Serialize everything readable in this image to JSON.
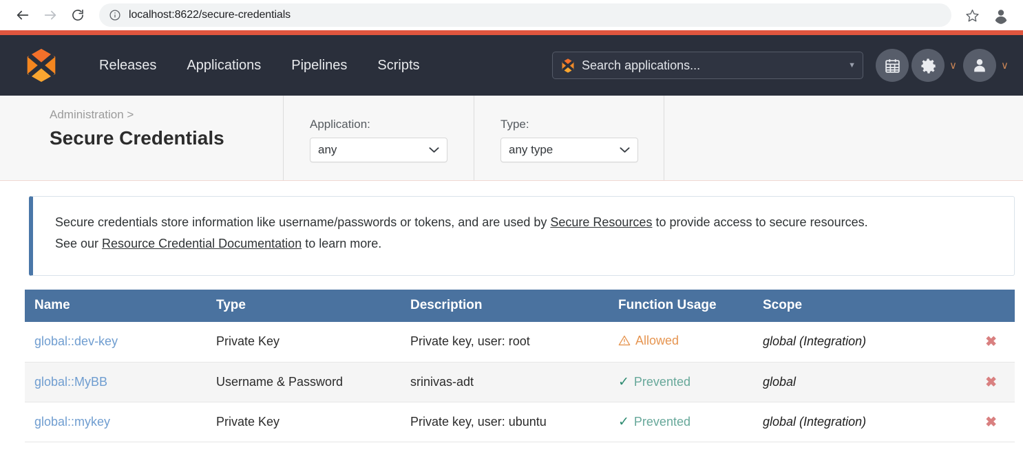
{
  "browser": {
    "back_icon": "arrow-left-icon",
    "forward_icon": "arrow-right-icon",
    "reload_icon": "reload-icon",
    "info_icon": "info-circle-icon",
    "url": "localhost:8622/secure-credentials",
    "star_icon": "star-icon",
    "profile_icon": "profile-avatar-icon"
  },
  "appnav": {
    "logo_name": "xebialabs-logo",
    "links": [
      {
        "label": "Releases"
      },
      {
        "label": "Applications"
      },
      {
        "label": "Pipelines"
      },
      {
        "label": "Scripts"
      }
    ],
    "search": {
      "placeholder": "Search applications...",
      "value": "",
      "logo_icon": "app-hex-logo-icon",
      "caret_icon": "caret-down-icon"
    },
    "actions": [
      {
        "name": "calendar-button",
        "icon": "calendar-icon",
        "chevron": ""
      },
      {
        "name": "settings-button",
        "icon": "gear-icon",
        "chevron": "∨"
      },
      {
        "name": "user-button",
        "icon": "user-icon",
        "chevron": "∨"
      }
    ]
  },
  "header": {
    "breadcrumb": "Administration >",
    "title": "Secure Credentials",
    "filters": [
      {
        "label": "Application:",
        "value": "any",
        "name": "application-filter"
      },
      {
        "label": "Type:",
        "value": "any type",
        "name": "type-filter"
      }
    ]
  },
  "banner": {
    "line1_part1": "Secure credentials store information like username/passwords or tokens, and are used by ",
    "line1_link": "Secure Resources",
    "line1_part2": " to provide access to secure resources.",
    "line2_part1": "See our ",
    "line2_link": "Resource Credential Documentation",
    "line2_part2": " to learn more."
  },
  "table": {
    "columns": [
      "Name",
      "Type",
      "Description",
      "Function Usage",
      "Scope",
      ""
    ],
    "rows": [
      {
        "name": "global::dev-key",
        "type": "Private Key",
        "description": "Private key, user: root",
        "usage": "Allowed",
        "usage_state": "allowed",
        "usage_icon": "warning-triangle-icon",
        "scope": "global (Integration)",
        "delete_icon": "delete-x-icon"
      },
      {
        "name": "global::MyBB",
        "type": "Username & Password",
        "description": "srinivas-adt",
        "usage": "Prevented",
        "usage_state": "prevented",
        "usage_icon": "check-icon",
        "scope": "global",
        "delete_icon": "delete-x-icon"
      },
      {
        "name": "global::mykey",
        "type": "Private Key",
        "description": "Private key, user: ubuntu",
        "usage": "Prevented",
        "usage_state": "prevented",
        "usage_icon": "check-icon",
        "scope": "global (Integration)",
        "delete_icon": "delete-x-icon"
      }
    ]
  },
  "colors": {
    "accent_stripe": "#e0563f",
    "nav_bg": "#2a2f3b",
    "table_header": "#4a729f",
    "link": "#6f9dd0",
    "allowed": "#e69551",
    "prevented": "#67a89a",
    "delete": "#d98080",
    "banner_border": "#4a77a8"
  }
}
